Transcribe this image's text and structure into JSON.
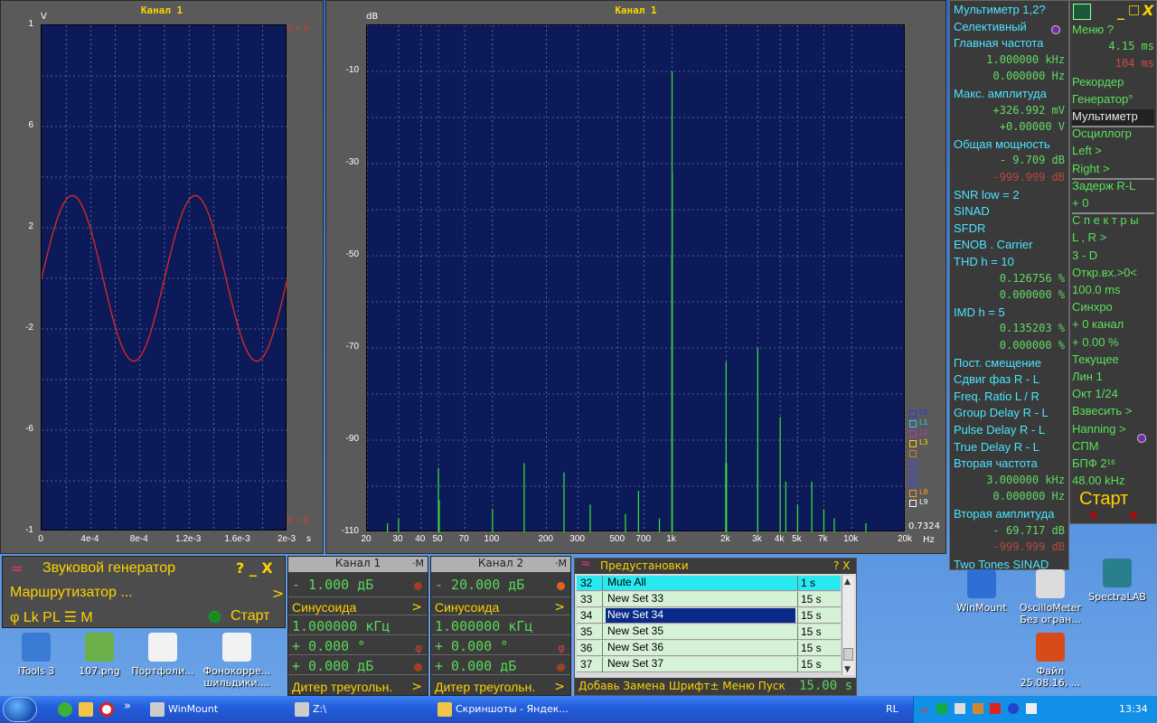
{
  "scope": {
    "title": "Канал 1",
    "y_unit": "V",
    "x_unit": "s",
    "corner_top": "0 ÷ 0",
    "corner_bottom": "0 ÷ 0",
    "chart_data": {
      "type": "line",
      "title": "Канал 1",
      "ylabel": "V",
      "xlabel": "s",
      "ylim": [
        -1,
        1
      ],
      "xlim": [
        0,
        0.002
      ],
      "yticks": [
        "1",
        "6",
        "2",
        "-2",
        "-6",
        "-1"
      ],
      "xticks": [
        "0",
        "4e-4",
        "8e-4",
        "1.2e-3",
        "1.6e-3",
        "2e-3"
      ],
      "series": [
        {
          "frequency_hz": 1000,
          "amplitude": 0.327
        }
      ]
    }
  },
  "spectrum": {
    "title": "Канал 1",
    "y_unit": "dB",
    "x_unit": "Hz",
    "cursor_value": "0.7324",
    "legend": [
      "L0",
      "L1",
      "L2",
      "L3",
      "",
      "",
      "",
      "",
      "L8",
      "L9"
    ],
    "chart_data": {
      "type": "line",
      "title": "Канал 1",
      "ylabel": "dB",
      "xlabel": "Hz",
      "ylim": [
        -110,
        0
      ],
      "xscale": "log",
      "xlim": [
        20,
        20000
      ],
      "yticks": [
        "-10",
        "-30",
        "-50",
        "-70",
        "-90",
        "-110"
      ],
      "xticks": [
        "20",
        "30",
        "40",
        "50",
        "70",
        "100",
        "200",
        "300",
        "500",
        "700",
        "1k",
        "2k",
        "3k",
        "4k",
        "5k",
        "7k",
        "10k",
        "20k"
      ],
      "peaks": [
        {
          "x": 26,
          "y": -108
        },
        {
          "x": 30,
          "y": -107
        },
        {
          "x": 50,
          "y": -96
        },
        {
          "x": 50.5,
          "y": -103
        },
        {
          "x": 100,
          "y": -105
        },
        {
          "x": 150,
          "y": -95
        },
        {
          "x": 250,
          "y": -97
        },
        {
          "x": 350,
          "y": -104
        },
        {
          "x": 550,
          "y": -106
        },
        {
          "x": 650,
          "y": -101
        },
        {
          "x": 850,
          "y": -107
        },
        {
          "x": 1000,
          "y": -10
        },
        {
          "x": 1002,
          "y": -32
        },
        {
          "x": 998,
          "y": -50
        },
        {
          "x": 2000,
          "y": -73
        },
        {
          "x": 3000,
          "y": -70
        },
        {
          "x": 3002,
          "y": -92
        },
        {
          "x": 4000,
          "y": -85
        },
        {
          "x": 4300,
          "y": -99
        },
        {
          "x": 5000,
          "y": -104
        },
        {
          "x": 6000,
          "y": -99
        },
        {
          "x": 7000,
          "y": -105
        },
        {
          "x": 8000,
          "y": -107
        },
        {
          "x": 12000,
          "y": -108
        },
        {
          "x": 1990,
          "y": -95
        },
        {
          "x": 2010,
          "y": -95
        }
      ]
    }
  },
  "multimeter": {
    "rows": [
      {
        "t": "Мультиметр 1,2?",
        "c": "title"
      },
      {
        "t": "Селективный",
        "c": "cy"
      },
      {
        "t": "Главная частота",
        "c": "cy"
      },
      {
        "t": "1.000000 kHz",
        "c": "v"
      },
      {
        "t": "0.000000  Hz",
        "c": "v"
      },
      {
        "t": "Макс. амплитуда",
        "c": "cy"
      },
      {
        "t": "+326.992 mV",
        "c": "v"
      },
      {
        "t": "+0.00000  V",
        "c": "v"
      },
      {
        "t": "Общая мощность",
        "c": "cy"
      },
      {
        "t": "-   9.709 dB",
        "c": "v"
      },
      {
        "t": "-999.999 dB",
        "c": "vr"
      },
      {
        "t": "SNR      low =  2",
        "c": "cy"
      },
      {
        "t": "SINAD",
        "c": "cy"
      },
      {
        "t": "SFDR",
        "c": "cy"
      },
      {
        "t": "ENOB . Carrier",
        "c": "cy"
      },
      {
        "t": "THD       h = 10",
        "c": "cy"
      },
      {
        "t": "0.126756 %",
        "c": "v"
      },
      {
        "t": "0.000000 %",
        "c": "v"
      },
      {
        "t": "IMD       h =  5",
        "c": "cy"
      },
      {
        "t": "0.135203 %",
        "c": "v"
      },
      {
        "t": "0.000000 %",
        "c": "v"
      },
      {
        "t": "Пост. смещение",
        "c": "cy"
      },
      {
        "t": "Сдвиг фаз R - L",
        "c": "cy"
      },
      {
        "t": "Freq. Ratio  L / R",
        "c": "cy"
      },
      {
        "t": "Group Delay R - L",
        "c": "cy"
      },
      {
        "t": "Pulse Delay R - L",
        "c": "cy"
      },
      {
        "t": "True Delay R - L",
        "c": "cy"
      },
      {
        "t": "Вторая частота",
        "c": "cy"
      },
      {
        "t": "3.000000 kHz",
        "c": "v"
      },
      {
        "t": "0.000000  Hz",
        "c": "v"
      },
      {
        "t": "Вторая амплитуда",
        "c": "cy"
      },
      {
        "t": "-  69.717 dB",
        "c": "v"
      },
      {
        "t": "-999.999 dB",
        "c": "vr"
      },
      {
        "t": "Two Tones SINAD",
        "c": "cy"
      }
    ]
  },
  "menu": {
    "title_buttons": [
      "_",
      "□",
      "X"
    ],
    "rows": [
      {
        "t": "Меню        ?",
        "c": "g"
      },
      {
        "t": "4.15 ms",
        "c": "r"
      },
      {
        "t": "104  ms",
        "c": "red"
      },
      {
        "t": "Рекордер",
        "c": "g"
      },
      {
        "t": "Генератор°",
        "c": "g"
      },
      {
        "t": "Мультиметр",
        "c": "w"
      },
      {
        "t": "Осциллогр",
        "c": "g"
      },
      {
        "t": "Left      >",
        "c": "g"
      },
      {
        "t": "Right     >",
        "c": "g"
      },
      {
        "t": "Задерж R-L",
        "c": "g"
      },
      {
        "t": "+        0",
        "c": "g"
      },
      {
        "t": "С п е к т р ы",
        "c": "g"
      },
      {
        "t": "L , R     >",
        "c": "g"
      },
      {
        "t": "3 - D",
        "c": "g"
      },
      {
        "t": "Откр.вх.>0<",
        "c": "g"
      },
      {
        "t": "100.0 ms",
        "c": "g"
      },
      {
        "t": "Синхро",
        "c": "g"
      },
      {
        "t": "+  0 канал",
        "c": "g"
      },
      {
        "t": "+  0.00 %",
        "c": "g"
      },
      {
        "t": "Текущее",
        "c": "g"
      },
      {
        "t": "Лин       1",
        "c": "g"
      },
      {
        "t": "Окт   1/24",
        "c": "g"
      },
      {
        "t": "Взвесить  >",
        "c": "g"
      },
      {
        "t": "Hanning   >",
        "c": "g"
      },
      {
        "t": "СПМ",
        "c": "g"
      },
      {
        "t": "БПФ    2¹⁶",
        "c": "g"
      },
      {
        "t": "48.00 kHz",
        "c": "g"
      }
    ],
    "start_label": "Старт"
  },
  "generator": {
    "title": "Звуковой генератор",
    "title_buttons": "?  _  X",
    "router": "Маршрутизатор ...",
    "router_arrow": ">",
    "bottom_left": "φ Lk PL ☰ M",
    "start": "Старт",
    "channels": [
      {
        "title": "Канал 1",
        "m": "·M",
        "level": "-   1.000 дБ",
        "wave": "Синусоида",
        "freq": "1.000000 кГц",
        "phase": "+   0.000 °",
        "gain": "+   0.000 дБ",
        "dither": "Дитер треугольн."
      },
      {
        "title": "Канал 2",
        "m": "·M",
        "level": "-  20.000 дБ",
        "wave": "Синусоида",
        "freq": "1.000000 кГц",
        "phase": "+   0.000 °",
        "gain": "+   0.000 дБ",
        "dither": "Дитер треугольн."
      }
    ]
  },
  "presets": {
    "title": "Предустановки",
    "title_buttons": "? X",
    "rows": [
      {
        "n": "32",
        "name": "Mute All",
        "t": "1 s"
      },
      {
        "n": "33",
        "name": "New Set 33",
        "t": "15 s"
      },
      {
        "n": "34",
        "name": "New Set 34",
        "t": "15 s"
      },
      {
        "n": "35",
        "name": "New Set 35",
        "t": "15 s"
      },
      {
        "n": "36",
        "name": "New Set 36",
        "t": "15 s"
      },
      {
        "n": "37",
        "name": "New Set 37",
        "t": "15 s"
      }
    ],
    "selected_index": 2,
    "footer": "Добавь Замена Шрифт± Меню Пуск",
    "footer_value": "15.00 s"
  },
  "desktop_icons": [
    {
      "label": "iTools 3",
      "color": "#3a7bd5"
    },
    {
      "label": "107.png",
      "color": "#6cb04a"
    },
    {
      "label": "Портфоли...",
      "color": "#f2f2f2"
    },
    {
      "label": "Фонокорре... шильдики....",
      "color": "#f2f2f2"
    },
    {
      "label": "WinMount",
      "color": "#2d6fd4"
    },
    {
      "label": "OscilloMeter Без огран...",
      "color": "#dcdcdc"
    },
    {
      "label": "SpectraLAB",
      "color": "#2a7f8f"
    },
    {
      "label": "Файл 25.08.16, ...",
      "color": "#d84a1a"
    }
  ],
  "taskbar": {
    "chevron": "»",
    "tasks": [
      "WinMount",
      "Z:\\",
      "Скриншоты - Яндек..."
    ],
    "lang": "RL",
    "clock": "13:34"
  }
}
